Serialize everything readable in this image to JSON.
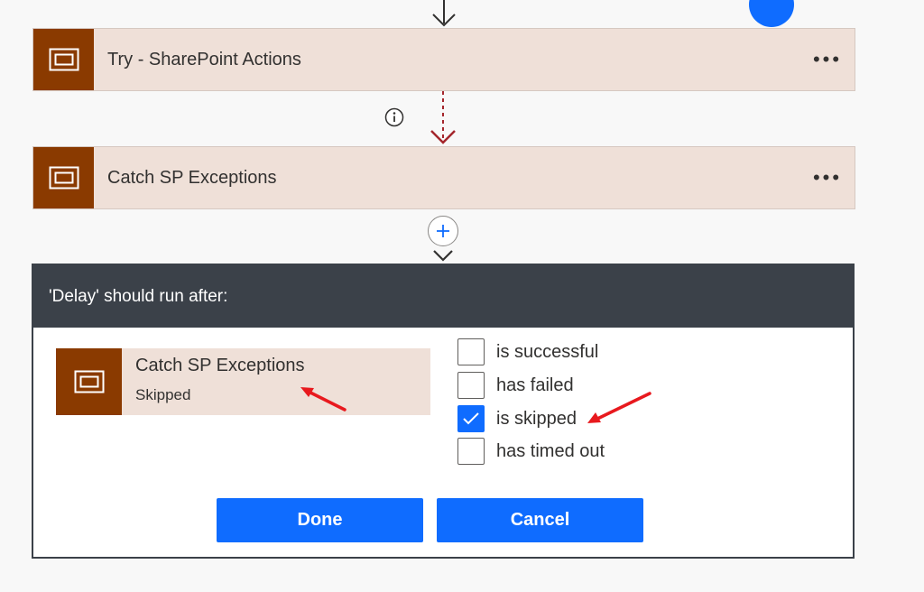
{
  "flow": {
    "actions": [
      {
        "title": "Try - SharePoint Actions",
        "icon": "scope-icon",
        "more_label": "•••"
      },
      {
        "title": "Catch SP Exceptions",
        "icon": "scope-icon",
        "more_label": "•••"
      }
    ],
    "info_icon": "info-icon",
    "add_icon": "plus-icon"
  },
  "dialog": {
    "header": "'Delay' should run after:",
    "dependency": {
      "name": "Catch SP Exceptions",
      "status": "Skipped"
    },
    "options": [
      {
        "label": "is successful",
        "checked": false
      },
      {
        "label": "has failed",
        "checked": false
      },
      {
        "label": "is skipped",
        "checked": true
      },
      {
        "label": "has timed out",
        "checked": false
      }
    ],
    "done_label": "Done",
    "cancel_label": "Cancel"
  },
  "colors": {
    "scope_brown": "#8a3a00",
    "card_bg": "#efe0d8",
    "accent_blue": "#0f6cff",
    "dialog_header": "#3b4149",
    "annotation_red": "#e8191e"
  }
}
